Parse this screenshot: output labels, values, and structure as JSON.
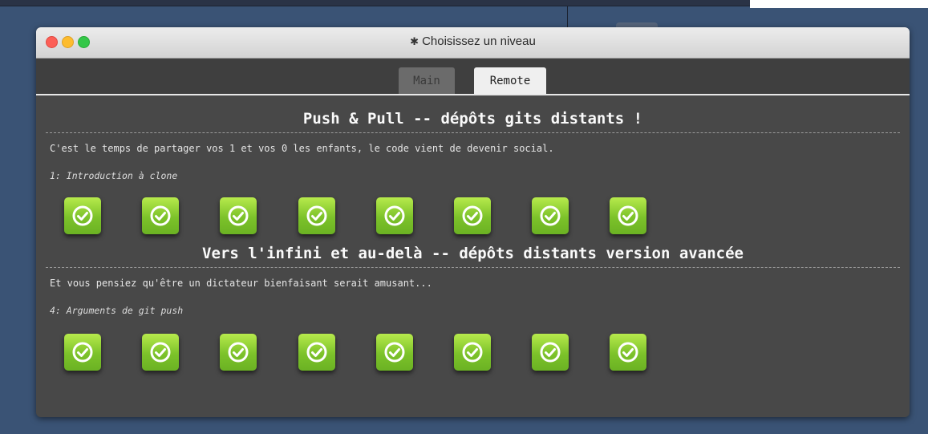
{
  "window": {
    "title": "Choisissez un niveau",
    "title_icon": "gear-icon"
  },
  "tabs": [
    {
      "label": "Main",
      "active": false
    },
    {
      "label": "Remote",
      "active": true
    }
  ],
  "sections": [
    {
      "title": "Push & Pull -- dépôts gits distants !",
      "description": "C'est le temps de partager vos 1 et vos 0 les enfants, le code vient de devenir social.",
      "level_name": "1: Introduction à clone",
      "levels": [
        "completed",
        "completed",
        "completed",
        "completed",
        "completed",
        "completed",
        "completed",
        "completed"
      ]
    },
    {
      "title": "Vers l'infini et au-delà -- dépôts distants version avancée",
      "description": "Et vous pensiez qu'être un dictateur bienfaisant serait amusant...",
      "level_name": "4: Arguments de git push",
      "levels": [
        "completed",
        "completed",
        "completed",
        "completed",
        "completed",
        "completed",
        "completed",
        "completed"
      ]
    }
  ],
  "colors": {
    "level_complete": "#7cc22a",
    "window_bg": "#484848",
    "desktop_bg": "#3a5375"
  }
}
